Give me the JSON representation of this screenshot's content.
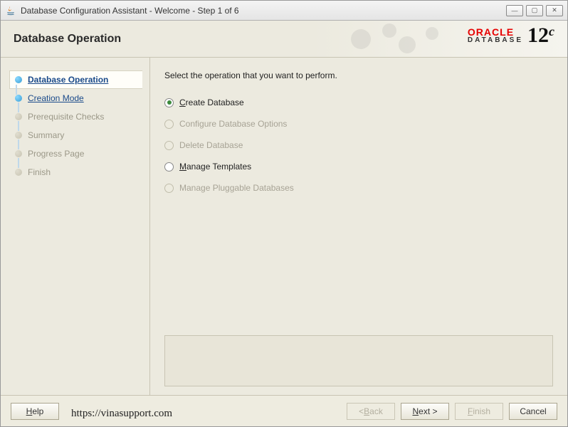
{
  "window": {
    "title": "Database Configuration Assistant - Welcome - Step 1 of 6"
  },
  "header": {
    "title": "Database Operation",
    "brand": "ORACLE",
    "brand_sub": "DATABASE",
    "version": "12",
    "version_suffix": "c"
  },
  "sidebar": {
    "steps": [
      {
        "label": "Database Operation"
      },
      {
        "label": "Creation Mode"
      },
      {
        "label": "Prerequisite Checks"
      },
      {
        "label": "Summary"
      },
      {
        "label": "Progress Page"
      },
      {
        "label": "Finish"
      }
    ]
  },
  "main": {
    "prompt": "Select the operation that you want to perform.",
    "options": [
      {
        "mnemonic": "C",
        "rest": "reate Database",
        "enabled": true,
        "selected": true
      },
      {
        "mnemonic": "",
        "rest": "Configure Database Options",
        "enabled": false,
        "selected": false
      },
      {
        "mnemonic": "",
        "rest": "Delete Database",
        "enabled": false,
        "selected": false
      },
      {
        "mnemonic": "M",
        "rest": "anage Templates",
        "enabled": true,
        "selected": false
      },
      {
        "mnemonic": "",
        "rest": "Manage Pluggable Databases",
        "enabled": false,
        "selected": false
      }
    ]
  },
  "footer": {
    "help_mnemonic": "H",
    "help_rest": "elp",
    "back_label": "< ",
    "back_mnemonic": "B",
    "back_rest": "ack",
    "next_mnemonic": "N",
    "next_rest": "ext >",
    "finish_mnemonic": "F",
    "finish_rest": "inish",
    "cancel": "Cancel"
  },
  "watermark": "https://vinasupport.com"
}
